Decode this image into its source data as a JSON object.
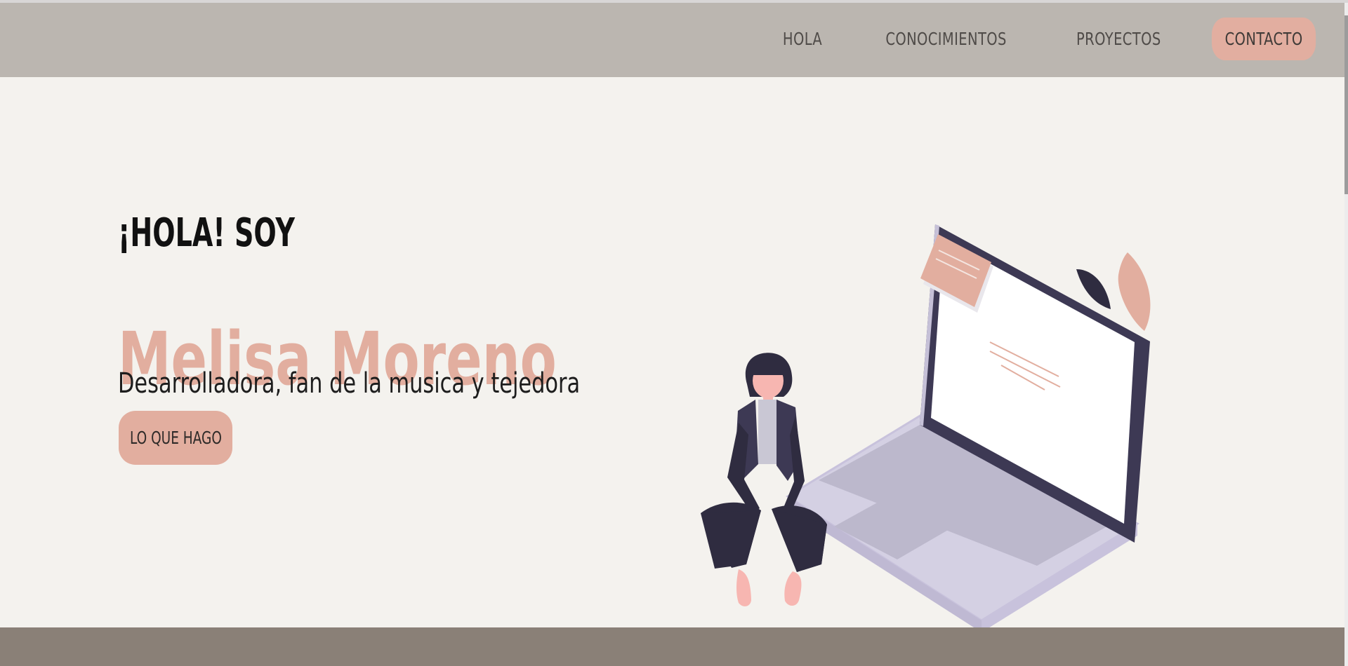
{
  "nav": {
    "items": [
      {
        "label": "HOLA"
      },
      {
        "label": "CONOCIMIENTOS"
      },
      {
        "label": "PROYECTOS"
      },
      {
        "label": "CONTACTO",
        "active": true
      }
    ]
  },
  "hero": {
    "greeting": "¡HOLA! SOY",
    "name": "Melisa Moreno",
    "tagline": "Desarrolladora, fan de la musica y tejedora",
    "cta_label": "LO QUE HAGO"
  },
  "colors": {
    "navbar_bg": "#bbb6b0",
    "page_bg": "#f4f2ee",
    "accent": "#e2ae9f",
    "footer_bg": "#8a8077"
  },
  "illustration": {
    "icon": "woman-sitting-on-laptop-illustration"
  }
}
